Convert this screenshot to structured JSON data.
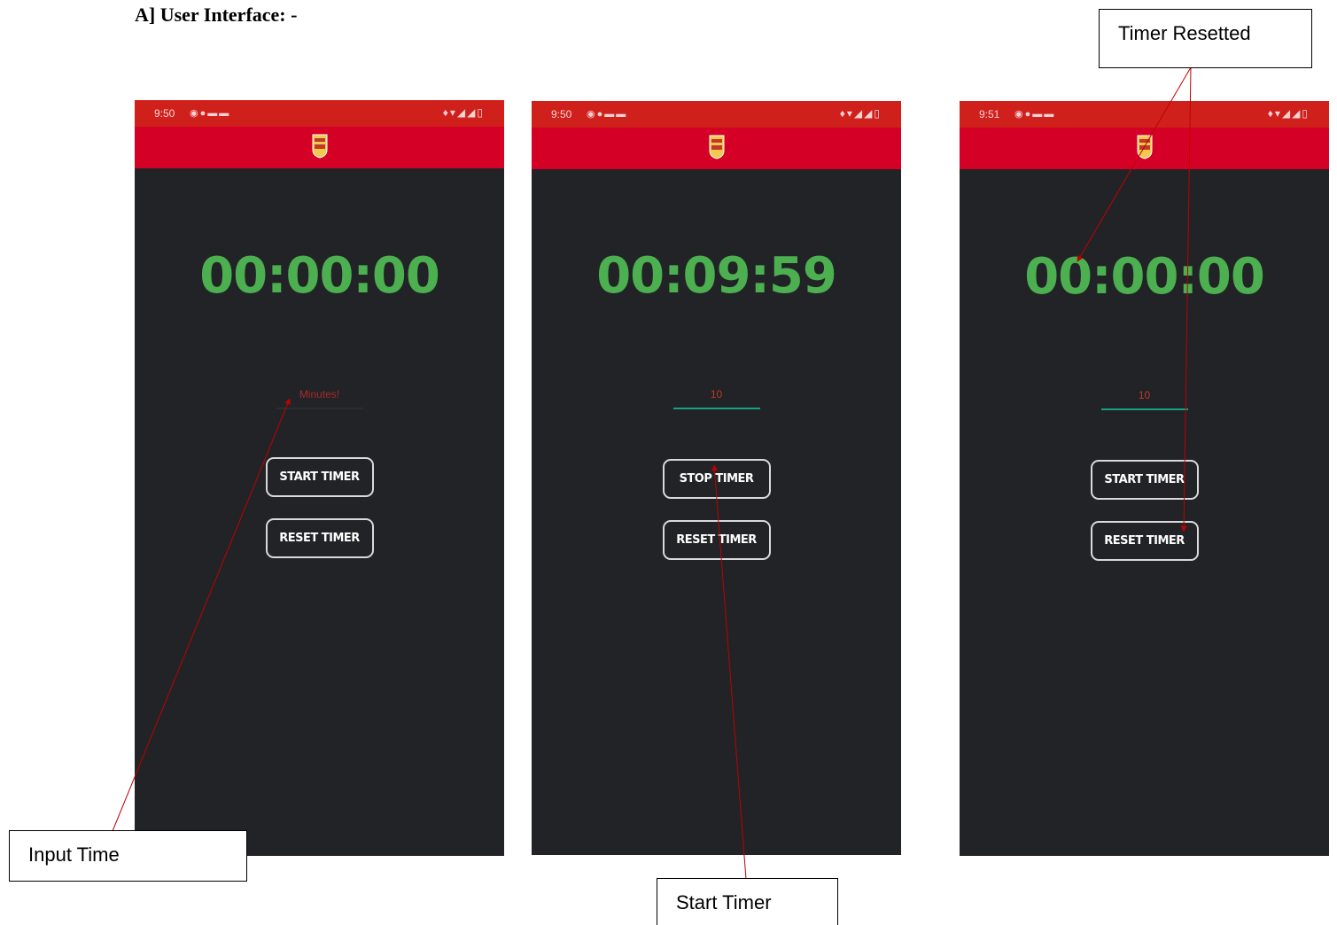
{
  "heading": "A] User Interface: -",
  "screens": [
    {
      "status_time": "9:50",
      "timer": "00:00:00",
      "minutes_value": "",
      "minutes_placeholder": "Minutes!",
      "primary_button": "START TIMER",
      "reset_button": "RESET TIMER",
      "field_focused": false
    },
    {
      "status_time": "9:50",
      "timer": "00:09:59",
      "minutes_value": "10",
      "minutes_placeholder": "",
      "primary_button": "STOP TIMER",
      "reset_button": "RESET TIMER",
      "field_focused": true
    },
    {
      "status_time": "9:51",
      "timer": "00:00:00",
      "minutes_value": "10",
      "minutes_placeholder": "",
      "primary_button": "START TIMER",
      "reset_button": "RESET TIMER",
      "field_focused": true
    }
  ],
  "status_icons": {
    "apps": [
      "whatsapp-icon",
      "github-icon",
      "youtube-icon",
      "youtube-icon"
    ],
    "system": [
      "bell-icon",
      "wifi-icon",
      "signal-icon",
      "signal-icon",
      "battery-icon"
    ]
  },
  "callouts": {
    "input_time": "Input Time",
    "start_timer": "Start Timer",
    "timer_resetted": "Timer Resetted"
  },
  "colors": {
    "statusbar": "#d0201c",
    "appbar": "#d40025",
    "screen_bg": "#222326",
    "timer_text": "#4caf50",
    "field_underline_focus": "#16a085",
    "arrow": "#c00000"
  }
}
